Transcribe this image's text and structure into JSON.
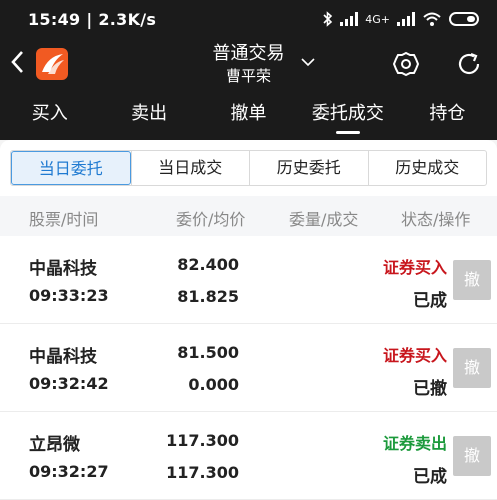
{
  "status_bar": {
    "time": "15:49",
    "speed": "2.3K/s",
    "network": "4G+"
  },
  "header": {
    "title": "普通交易",
    "subtitle": "曹平荣"
  },
  "main_tabs": [
    {
      "label": "买入"
    },
    {
      "label": "卖出"
    },
    {
      "label": "撤单"
    },
    {
      "label": "委托成交",
      "active": true
    },
    {
      "label": "持仓"
    }
  ],
  "sub_tabs": [
    {
      "label": "当日委托",
      "active": true
    },
    {
      "label": "当日成交"
    },
    {
      "label": "历史委托"
    },
    {
      "label": "历史成交"
    }
  ],
  "columns": [
    "股票/时间",
    "委价/均价",
    "委量/成交",
    "状态/操作"
  ],
  "orders": [
    {
      "name": "中晶科技",
      "time": "09:33:23",
      "price": "82.400",
      "avg": "81.825",
      "type": "证券买入",
      "side": "buy",
      "state": "已成",
      "action": "撤"
    },
    {
      "name": "中晶科技",
      "time": "09:32:42",
      "price": "81.500",
      "avg": "0.000",
      "type": "证券买入",
      "side": "buy",
      "state": "已撤",
      "action": "撤"
    },
    {
      "name": "立昂微",
      "time": "09:32:27",
      "price": "117.300",
      "avg": "117.300",
      "type": "证券卖出",
      "side": "sell",
      "state": "已成",
      "action": "撤"
    }
  ],
  "colors": {
    "buy": "#c8161d",
    "sell": "#1c9a3c",
    "accent": "#1f7ad1",
    "brand": "#f15a22"
  }
}
